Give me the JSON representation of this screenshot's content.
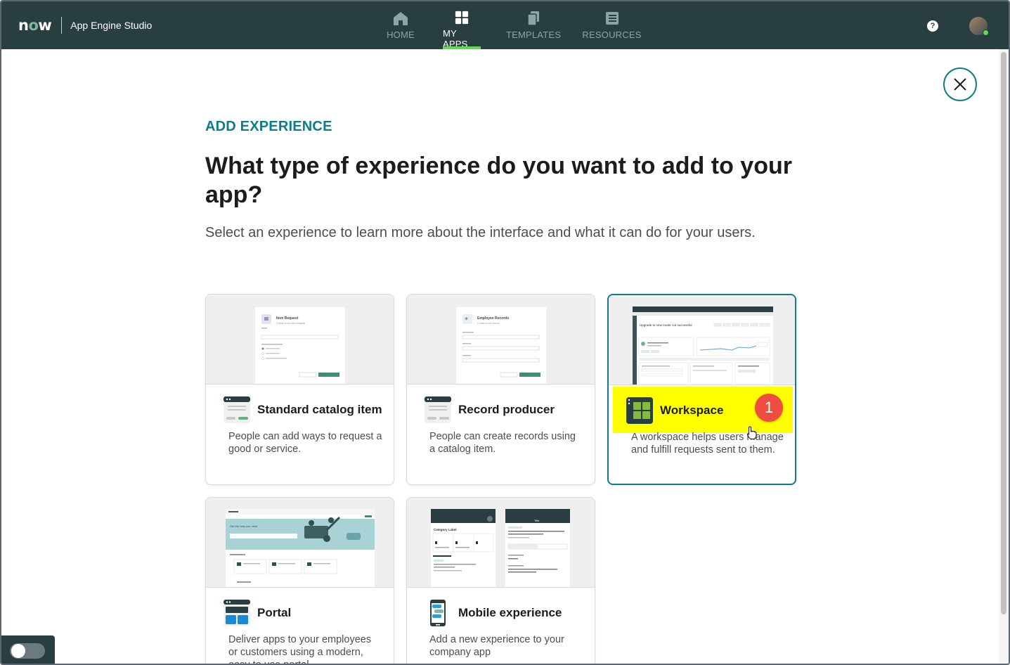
{
  "header": {
    "logo": "now",
    "app_title": "App Engine Studio",
    "nav": [
      {
        "label": "HOME",
        "icon": "home-icon",
        "active": false
      },
      {
        "label": "MY APPS",
        "icon": "apps-grid-icon",
        "active": true
      },
      {
        "label": "TEMPLATES",
        "icon": "templates-icon",
        "active": false
      },
      {
        "label": "RESOURCES",
        "icon": "resources-icon",
        "active": false
      }
    ],
    "help": "?"
  },
  "page": {
    "eyebrow": "ADD EXPERIENCE",
    "title": "What type of experience do you want to add to your app?",
    "subtitle": "Select an experience to learn more about the interface and what it can do for your users."
  },
  "cards": [
    {
      "name": "Standard catalog item",
      "description": "People can add ways to request a good or service.",
      "selected": false,
      "preview": {
        "title": "Item Request",
        "sub": "Create a new item request"
      }
    },
    {
      "name": "Record producer",
      "description": "People can create records using a catalog item.",
      "selected": false,
      "preview": {
        "title": "Employee Records",
        "sub": "Create a new record"
      }
    },
    {
      "name": "Workspace",
      "description": "A workspace helps users manage and fulfill requests sent to them.",
      "selected": true,
      "preview": {
        "title": "Upgrade to new router not successful"
      }
    },
    {
      "name": "Portal",
      "description": "Deliver apps to your employees or customers using a modern, easy to use portal.",
      "selected": false,
      "preview": {
        "title": "Get the help you need"
      }
    },
    {
      "name": "Mobile experience",
      "description": "Add a new experience to your company app",
      "selected": false,
      "preview": {
        "left_title": "Category Label",
        "right_title": "Title"
      }
    }
  ],
  "annotation": {
    "step": "1",
    "color": "#ef4d40",
    "highlight": "#ffff00"
  },
  "colors": {
    "topbar": "#293e40",
    "accent": "#0e7d89",
    "active_tab": "#62d84e"
  }
}
